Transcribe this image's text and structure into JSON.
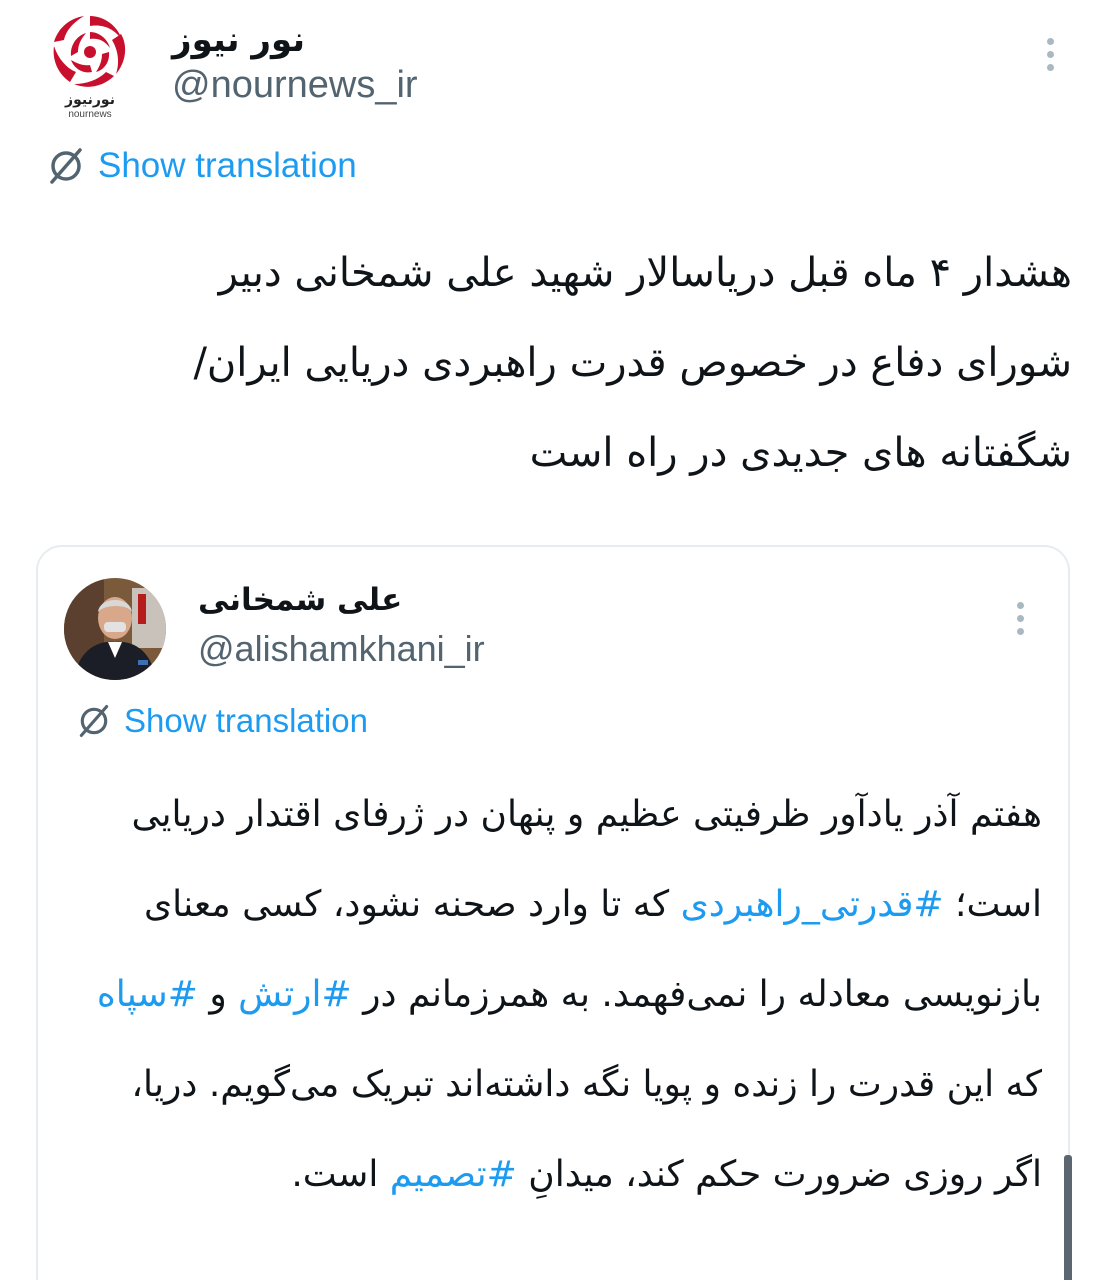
{
  "tweet": {
    "author_name": "نور نیوز",
    "author_handle": "@nournews_ir",
    "logo_text": "نورنیوز",
    "logo_subtext": "nournews",
    "show_translation": "Show translation",
    "text": "هشدار ۴ ماه قبل دریاسالار شهید علی شمخانی دبیر\nشورای دفاع در خصوص قدرت راهبردی دریایی ایران/\nشگفتانه های جدیدی در راه است"
  },
  "quote": {
    "author_name": "علی شمخانی",
    "author_handle": "@alishamkhani_ir",
    "show_translation": "Show translation",
    "segments": {
      "s1": "هفتم آذر یادآور ظرفیتی عظیم و پنهان در ژرفای اقتدار دریایی است؛ ",
      "h1": "#قدرتی_راهبردی",
      "s2": " که تا وارد صحنه نشود، کسی معنای بازنویسی معادله را نمی‌فهمد. به همرزمانم در ",
      "h2": "#ارتش",
      "s3": " و ",
      "h3": "#سپاه",
      "s4": " که این قدرت را زنده و پویا نگه داشته‌اند تبریک می‌گویم. دریا، اگر روزی ضرورت حکم کند، میدانِ ",
      "h4": "#تصمیم",
      "s5": " است."
    }
  },
  "colors": {
    "link": "#1d9bf0",
    "secondary_text": "#536471",
    "logo_red": "#c8102e",
    "border": "#e6ecf0"
  },
  "icons": {
    "translate": "translate-icon",
    "more": "more-options-icon"
  }
}
